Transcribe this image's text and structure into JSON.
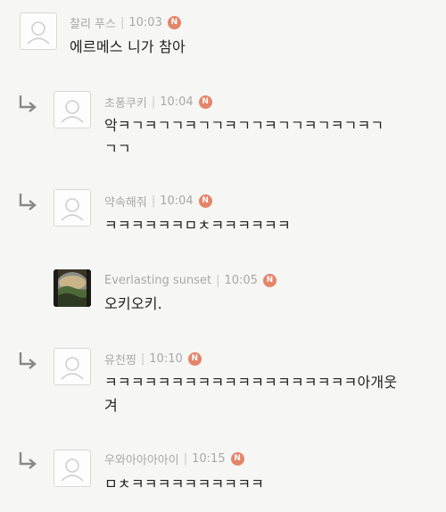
{
  "comments": [
    {
      "author": "찰리 푸스",
      "time": "10:03",
      "badge": "N",
      "text": "에르메스 니가 참아"
    },
    {
      "author": "초퐁쿠키",
      "time": "10:04",
      "badge": "N",
      "text_line1": "악ㅋㄱㅋㄱㄱㅋㄱㄱㅋㄱㄱㅋㄱㄱㅋㄱㅋㄱㅋㄱ",
      "text_line2": "ㄱㄱ"
    },
    {
      "author": "약속해줘",
      "time": "10:04",
      "badge": "N",
      "text": "ㅋㅋㅋㅋㅋㅋㅁㅊㅋㅋㅋㅋㅋㅋ"
    },
    {
      "author": "Everlasting sunset",
      "time": "10:05",
      "badge": "N",
      "text": "오키오키."
    },
    {
      "author": "유천찡",
      "time": "10:10",
      "badge": "N",
      "text_line1": "ㅋㅋㅋㅋㅋㅋㅋㅋㅋㅋㅋㅋㅋㅋㅋㅋㅋㅋㅋ아개웃",
      "text_line2": "겨"
    },
    {
      "author": "우와아아아아이",
      "time": "10:15",
      "badge": "N",
      "text": "ㅁㅊㅋㅋㅋㅋㅋㅋㅋㅋㅋㅋ"
    }
  ],
  "icons": {
    "reply": "reply-arrow-icon",
    "avatar": "default-avatar-icon",
    "photo": "sunset-photo-avatar"
  },
  "colors": {
    "badge": "#e4856a",
    "meta": "#a8a8a8",
    "arrow": "#888888"
  }
}
